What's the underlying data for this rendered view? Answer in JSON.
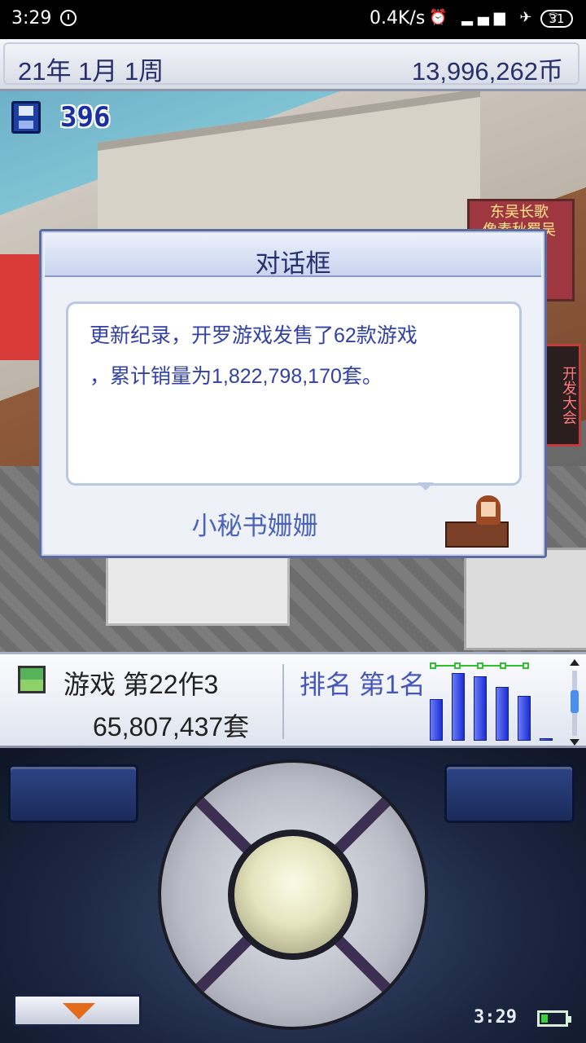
{
  "status_bar": {
    "time": "3:29",
    "network_speed": "0.4K/s",
    "status_icons": "⏰ ▂▄▆ ✈ ⌔",
    "battery": "31"
  },
  "top_bar": {
    "date": "21年 1月 1周",
    "money": "13,996,262币"
  },
  "game_view": {
    "save_points": "396",
    "poster_text": "东吴长歌\n像素秋蜀吴",
    "sign_text": "开发大会"
  },
  "dialog": {
    "title": "对话框",
    "message_line1": "更新纪录，开罗游戏发售了62款游戏",
    "message_line2": "，累计销量为1,822,798,170套。",
    "speaker": "小秘书姗姗"
  },
  "info_panel": {
    "game_name": "游戏 第22作3",
    "sales": "65,807,437套",
    "rank": "排名 第1名",
    "chart_data": {
      "type": "bar",
      "values": [
        55,
        90,
        86,
        72,
        60,
        3
      ],
      "ylim": [
        0,
        100
      ]
    }
  },
  "controls": {
    "clock": "3:29",
    "accent_color": "#e36b1b"
  }
}
